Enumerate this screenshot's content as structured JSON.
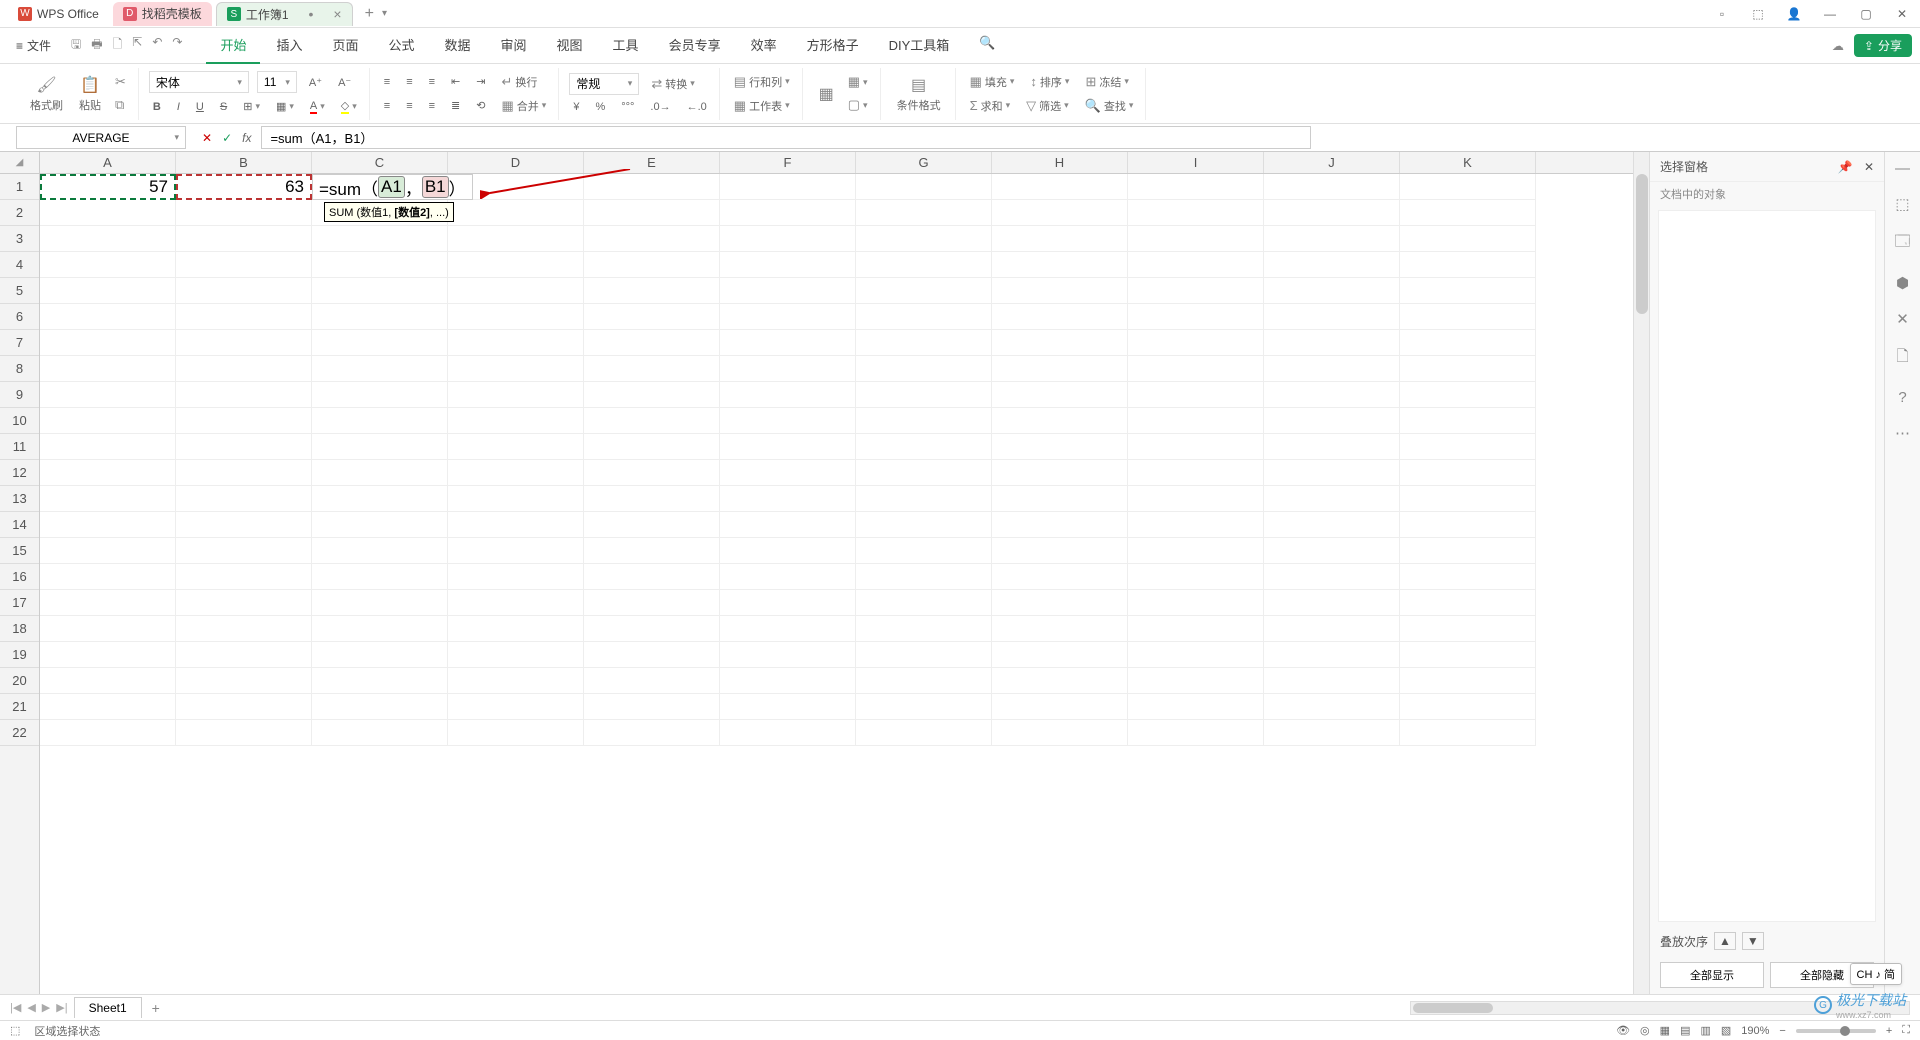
{
  "titlebar": {
    "app_tab": "WPS Office",
    "template_tab": "找稻壳模板",
    "doc_tab": "工作簿1",
    "win_ico_box": "▫",
    "win_ico_cube": "⬚",
    "win_ico_user": "👤",
    "win_min": "—",
    "win_max": "▢",
    "win_close": "✕"
  },
  "menubar": {
    "file": "文件",
    "qat": {
      "save": "🖫",
      "print": "🖶",
      "preview": "🗋",
      "undo": "↶",
      "redo": "↷"
    },
    "tabs": [
      "开始",
      "插入",
      "页面",
      "公式",
      "数据",
      "审阅",
      "视图",
      "工具",
      "会员专享",
      "效率",
      "方形格子",
      "DIY工具箱"
    ],
    "search_icon": "🔍",
    "cloud_icon": "☁",
    "share": "分享"
  },
  "ribbon": {
    "clipboard": {
      "fmt_painter": "格式刷",
      "paste": "粘贴",
      "cut": "✂"
    },
    "font_name": "宋体",
    "font_size": "11",
    "style_btns": {
      "bold": "B",
      "italic": "I",
      "underline": "U",
      "strike": "S",
      "border": "⊞",
      "fill": "▦",
      "fontcolor": "A"
    },
    "number": {
      "general": "常规",
      "convert": "转换",
      "rowcol": "行和列",
      "worksheet": "工作表"
    },
    "cells": {
      "merge": "合并",
      "wrap": "换行"
    },
    "cond": "条件格式",
    "fill": "填充",
    "sort": "排序",
    "freeze": "冻结",
    "sum": "求和",
    "filter": "筛选",
    "find": "查找"
  },
  "fbar": {
    "namebox": "AVERAGE",
    "cancel": "✕",
    "confirm": "✓",
    "fx": "fx",
    "formula": "=sum（A1，B1）"
  },
  "grid": {
    "cols": [
      "A",
      "B",
      "C",
      "D",
      "E",
      "F",
      "G",
      "H",
      "I",
      "J",
      "K"
    ],
    "rows": 22,
    "A1": "57",
    "B1": "63",
    "C1_prefix": "=sum（",
    "C1_ref1": "A1",
    "C1_comma": "，",
    "C1_ref2": "B1",
    "C1_suffix": "）",
    "tooltip_p1": "SUM (数值1, ",
    "tooltip_bold": "[数值2]",
    "tooltip_p2": ", ...)"
  },
  "sidepanel": {
    "title": "选择窗格",
    "pin": "📌",
    "close": "✕",
    "sub": "文档中的对象",
    "stack_label": "叠放次序",
    "arrow_up": "▲",
    "arrow_down": "▼",
    "show_all": "全部显示",
    "hide_all": "全部隐藏"
  },
  "iconstrip": [
    "—",
    "⬚",
    "🗔",
    "⬢",
    "✕",
    "🗋",
    "?",
    "⋯"
  ],
  "sheettabs": {
    "nav": [
      "|◀",
      "◀",
      "▶",
      "▶|"
    ],
    "sheet": "Sheet1",
    "add": "+"
  },
  "statusbar": {
    "mode_icon": "⬚",
    "mode": "区域选择状态",
    "eye": "👁",
    "target": "◎",
    "views": [
      "▦",
      "▤",
      "▥",
      "▧"
    ],
    "zoom": "190%",
    "minus": "−",
    "plus": "+"
  },
  "ime": "CH ♪ 简",
  "watermark": {
    "main": "极光下载站",
    "sub": "www.xz7.com"
  }
}
